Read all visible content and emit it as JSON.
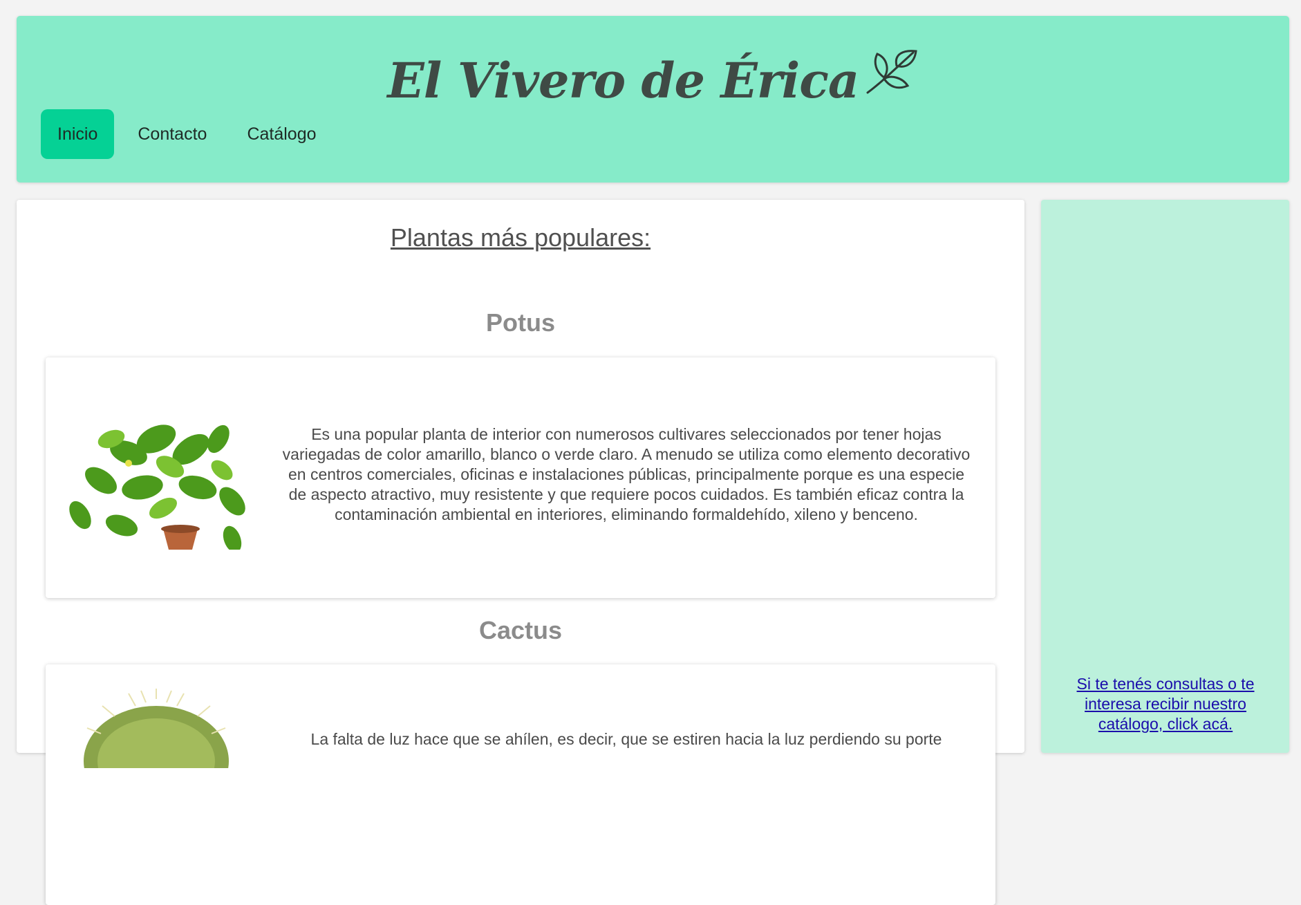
{
  "header": {
    "title": "El Vivero de Érica",
    "logo_icon": "leaf-branch-icon"
  },
  "nav": {
    "items": [
      {
        "label": "Inicio",
        "active": true
      },
      {
        "label": "Contacto",
        "active": false
      },
      {
        "label": "Catálogo",
        "active": false
      }
    ]
  },
  "main": {
    "title": "Plantas más populares:",
    "plants": [
      {
        "name": "Potus",
        "description": "Es una popular planta de interior con numerosos cultivares seleccionados por tener hojas variegadas de color amarillo, blanco o verde claro. A menudo se utiliza como elemento decorativo en centros comerciales, oficinas e instalaciones públicas, principalmente porque es una especie de aspecto atractivo, muy resistente y que requiere pocos cuidados. Es también eficaz contra la contaminación ambiental en interiores, eliminando formaldehído, xileno y benceno."
      },
      {
        "name": "Cactus",
        "description": "La falta de luz hace que se ahílen, es decir, que se estiren hacia la luz perdiendo su porte"
      }
    ]
  },
  "sidebar": {
    "link_text": "Si te tenés consultas o te interesa recibir nuestro catálogo, click acá."
  },
  "colors": {
    "header_bg": "#86ebc9",
    "nav_active": "#05d195",
    "sidebar_bg": "#bcf1dc",
    "link": "#1a0dab"
  }
}
